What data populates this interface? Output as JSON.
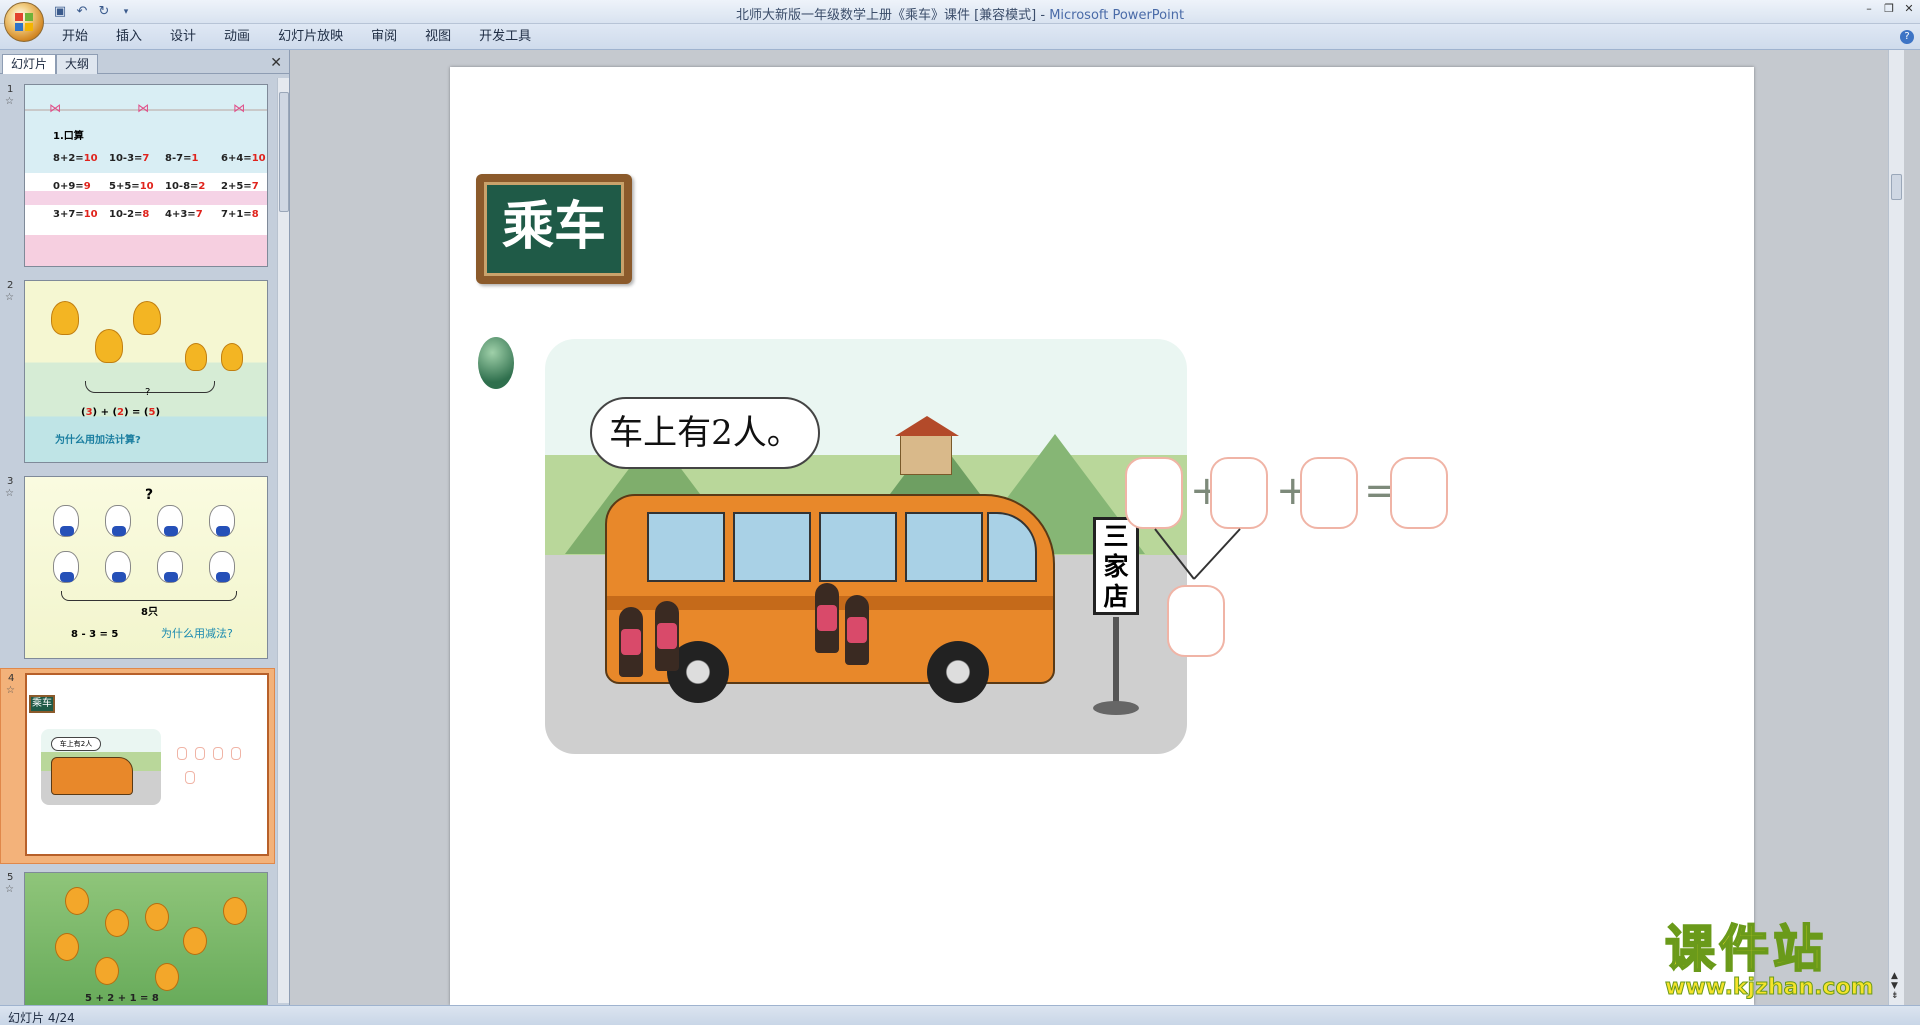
{
  "window": {
    "title": "北师大新版一年级数学上册《乘车》课件 [兼容模式]",
    "app_name": "Microsoft PowerPoint"
  },
  "ribbon": {
    "tabs": [
      "开始",
      "插入",
      "设计",
      "动画",
      "幻灯片放映",
      "审阅",
      "视图",
      "开发工具"
    ]
  },
  "left_pane": {
    "tabs": [
      "幻灯片",
      "大纲"
    ],
    "slides": [
      {
        "num": "1",
        "title": "1.口算",
        "rows": [
          [
            [
              "8+2=",
              "10"
            ],
            [
              "10-3=",
              "7"
            ],
            [
              "8-7=",
              "1"
            ],
            [
              "6+4=",
              "10"
            ]
          ],
          [
            [
              "0+9=",
              "9"
            ],
            [
              "5+5=",
              "10"
            ],
            [
              "10-8=",
              "2"
            ],
            [
              "2+5=",
              "7"
            ]
          ],
          [
            [
              "3+7=",
              "10"
            ],
            [
              "10-2=",
              "8"
            ],
            [
              "4+3=",
              "7"
            ],
            [
              "7+1=",
              "8"
            ]
          ]
        ]
      },
      {
        "num": "2",
        "question_mark": "?",
        "equation": [
          "(",
          "3",
          ") + (",
          "2",
          ") = (",
          "5",
          ")"
        ],
        "note": "为什么用加法计算?"
      },
      {
        "num": "3",
        "question_mark": "?",
        "count_label": "8只",
        "equation": "8 - 3 = 5",
        "note": "为什么用减法?"
      },
      {
        "num": "4",
        "title": "乘车",
        "bubble": "车上有2人"
      },
      {
        "num": "5",
        "equation": "5 + 2 + 1 = 8"
      }
    ]
  },
  "slide": {
    "title": "乘车",
    "speech_bubble": "车上有2人。",
    "sign_text": "三家店",
    "equation_operators": [
      "+",
      "+",
      "="
    ]
  },
  "watermark": {
    "cn": "课件站",
    "url": "www.kjzhan.com"
  },
  "status": {
    "slide_indicator": "幻灯片 4/24"
  },
  "colors": {
    "title_board": "#1f5a47",
    "bus": "#e8882a",
    "eq_box_border": "#f0b4a6",
    "selected_thumb": "#f3b27a"
  }
}
